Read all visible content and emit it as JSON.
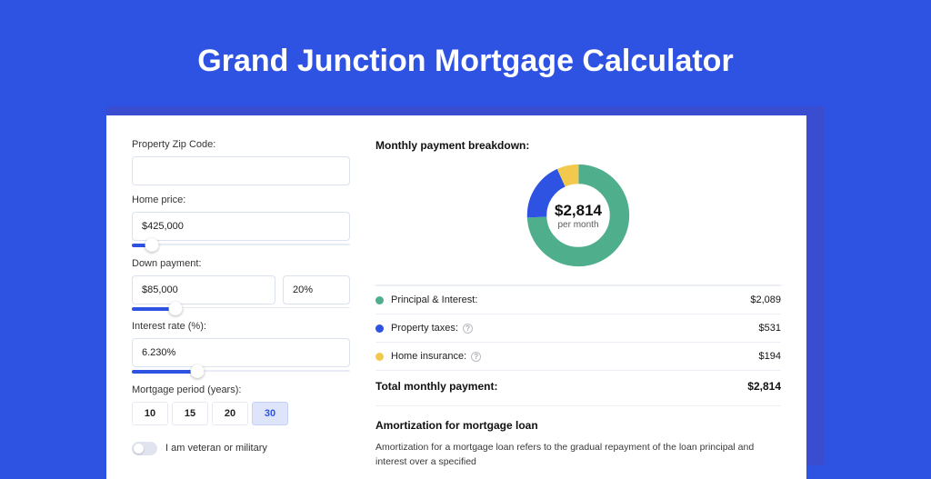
{
  "title": "Grand Junction Mortgage Calculator",
  "colors": {
    "pi": "#4fae8c",
    "tax": "#2e53e3",
    "ins": "#f2c94c"
  },
  "form": {
    "zip_label": "Property Zip Code:",
    "zip_value": "",
    "home_label": "Home price:",
    "home_value": "$425,000",
    "home_slider_pct": 9,
    "dp_label": "Down payment:",
    "dp_value": "$85,000",
    "dp_pct": "20%",
    "dp_slider_pct": 20,
    "rate_label": "Interest rate (%):",
    "rate_value": "6.230%",
    "rate_slider_pct": 30,
    "period_label": "Mortgage period (years):",
    "periods": [
      "10",
      "15",
      "20",
      "30"
    ],
    "period_active": "30",
    "veteran_label": "I am veteran or military"
  },
  "breakdown": {
    "title": "Monthly payment breakdown:",
    "amount": "$2,814",
    "sub": "per month",
    "items": [
      {
        "label": "Principal & Interest:",
        "value": "$2,089",
        "help": false,
        "color": "pi"
      },
      {
        "label": "Property taxes:",
        "value": "$531",
        "help": true,
        "color": "tax"
      },
      {
        "label": "Home insurance:",
        "value": "$194",
        "help": true,
        "color": "ins"
      }
    ],
    "total_label": "Total monthly payment:",
    "total_value": "$2,814"
  },
  "chart_data": {
    "type": "pie",
    "title": "Monthly payment breakdown",
    "series": [
      {
        "name": "Principal & Interest",
        "value": 2089,
        "color": "#4fae8c"
      },
      {
        "name": "Property taxes",
        "value": 531,
        "color": "#2e53e3"
      },
      {
        "name": "Home insurance",
        "value": 194,
        "color": "#f2c94c"
      }
    ],
    "total": 2814,
    "center_label": "$2,814",
    "center_sub": "per month"
  },
  "amort": {
    "title": "Amortization for mortgage loan",
    "text": "Amortization for a mortgage loan refers to the gradual repayment of the loan principal and interest over a specified"
  }
}
